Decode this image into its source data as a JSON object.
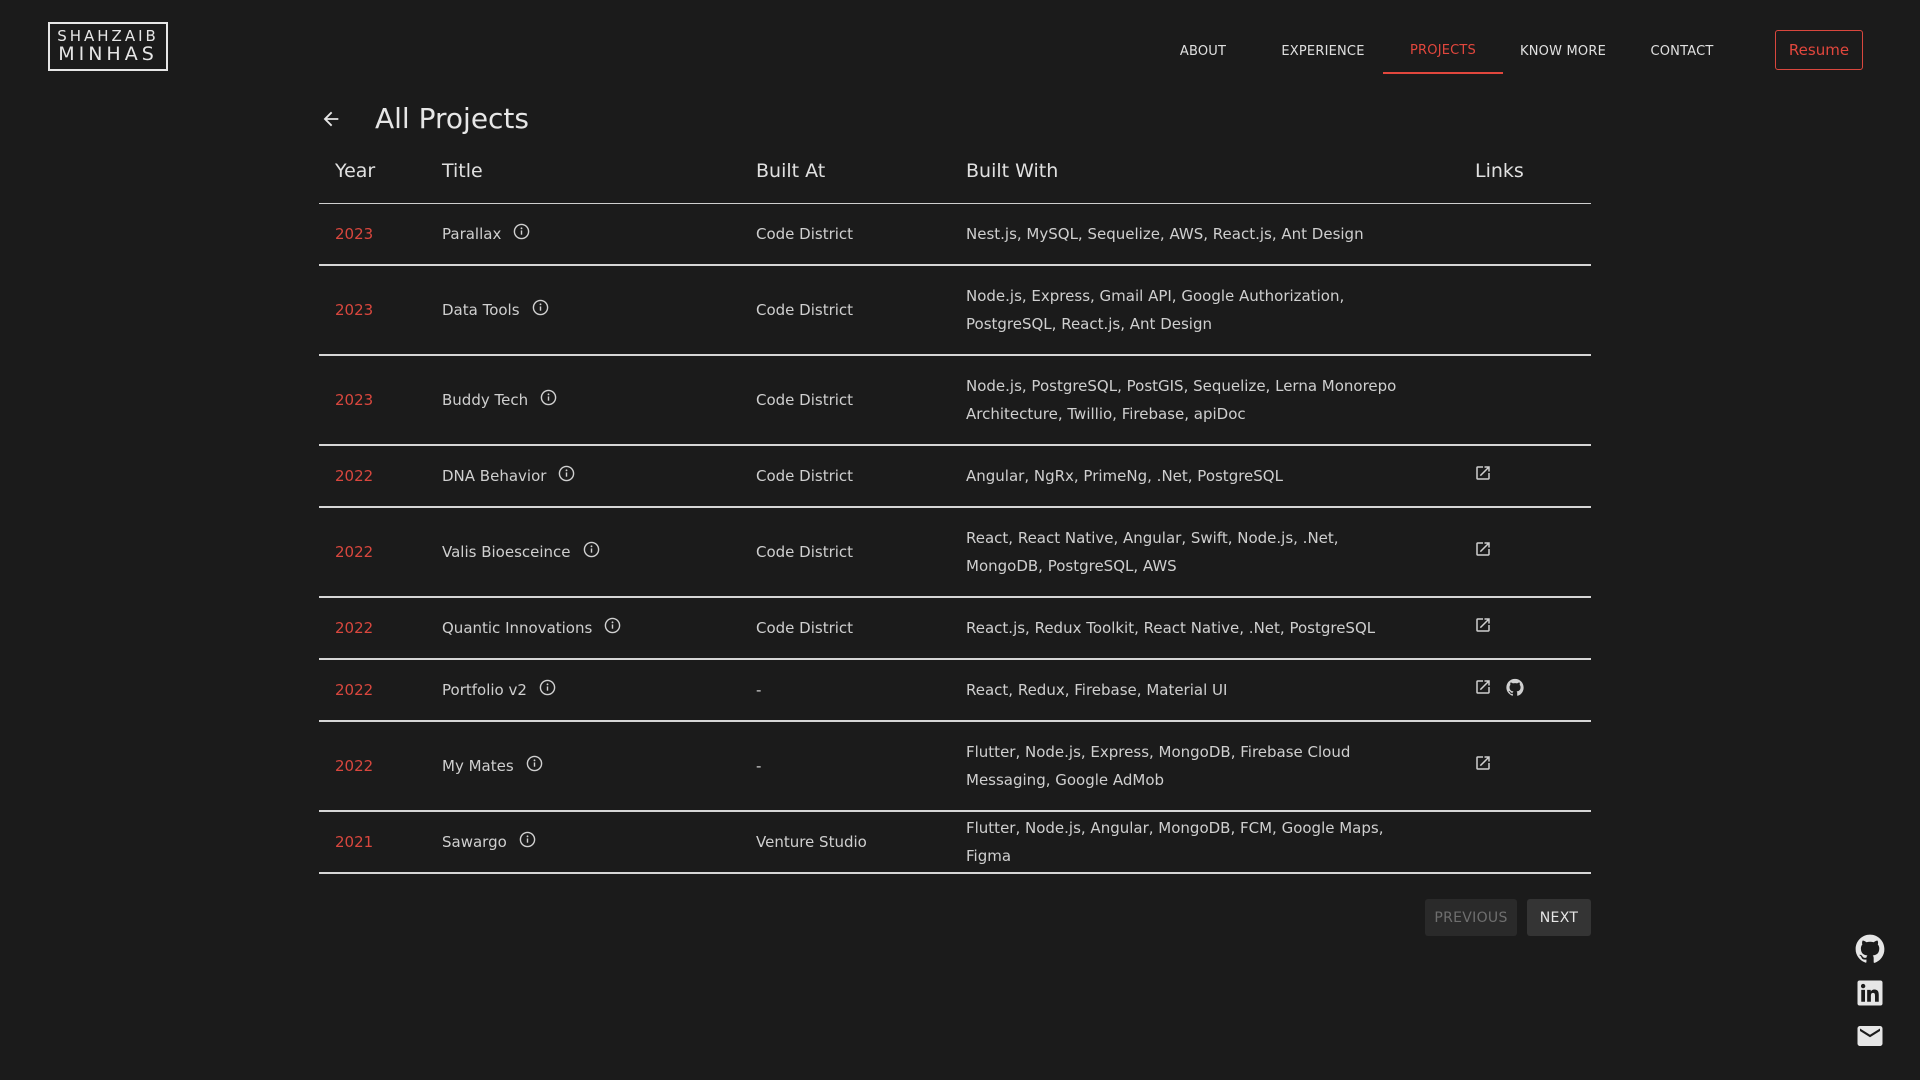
{
  "logo": {
    "line1": "SHAHZAIB",
    "line2": "MINHAS"
  },
  "nav": {
    "about": "ABOUT",
    "experience": "EXPERIENCE",
    "projects": "PROJECTS",
    "know_more": "KNOW MORE",
    "contact": "CONTACT",
    "resume": "Resume",
    "active": "PROJECTS"
  },
  "page": {
    "title": "All Projects"
  },
  "table": {
    "headers": {
      "year": "Year",
      "title": "Title",
      "built_at": "Built At",
      "built_with": "Built With",
      "links": "Links"
    },
    "rows": [
      {
        "year": "2023",
        "title": "Parallax",
        "built_at": "Code District",
        "built_with": "Nest.js, MySQL, Sequelize, AWS, React.js, Ant Design",
        "links": []
      },
      {
        "year": "2023",
        "title": "Data Tools",
        "built_at": "Code District",
        "built_with": "Node.js, Express, Gmail API, Google Authorization, PostgreSQL, React.js, Ant Design",
        "links": []
      },
      {
        "year": "2023",
        "title": "Buddy Tech",
        "built_at": "Code District",
        "built_with": "Node.js, PostgreSQL, PostGIS, Sequelize, Lerna Monorepo Architecture, Twillio, Firebase, apiDoc",
        "links": []
      },
      {
        "year": "2022",
        "title": "DNA Behavior",
        "built_at": "Code District",
        "built_with": "Angular, NgRx, PrimeNg, .Net, PostgreSQL",
        "links": [
          "external-link-icon"
        ]
      },
      {
        "year": "2022",
        "title": "Valis Bioesceince",
        "built_at": "Code District",
        "built_with": "React, React Native, Angular, Swift, Node.js, .Net, MongoDB, PostgreSQL, AWS",
        "links": [
          "external-link-icon"
        ]
      },
      {
        "year": "2022",
        "title": "Quantic Innovations",
        "built_at": "Code District",
        "built_with": "React.js, Redux Toolkit, React Native, .Net, PostgreSQL",
        "links": [
          "external-link-icon"
        ]
      },
      {
        "year": "2022",
        "title": "Portfolio v2",
        "built_at": "-",
        "built_with": "React, Redux, Firebase, Material UI",
        "links": [
          "external-link-icon",
          "github-icon"
        ]
      },
      {
        "year": "2022",
        "title": "My Mates",
        "built_at": "-",
        "built_with": "Flutter, Node.js, Express, MongoDB, Firebase Cloud Messaging, Google AdMob",
        "links": [
          "external-link-icon"
        ]
      },
      {
        "year": "2021",
        "title": "Sawargo",
        "built_at": "Venture Studio",
        "built_with": "Flutter, Node.js, Angular, MongoDB, FCM, Google Maps, Figma",
        "links": []
      }
    ]
  },
  "pagination": {
    "previous": "PREVIOUS",
    "next": "NEXT",
    "previous_disabled": true
  },
  "social": [
    "github-icon",
    "linkedin-icon",
    "mail-icon"
  ],
  "colors": {
    "background": "#1b1b1b",
    "accent": "#e2473d",
    "text": "#d9d9d9"
  }
}
